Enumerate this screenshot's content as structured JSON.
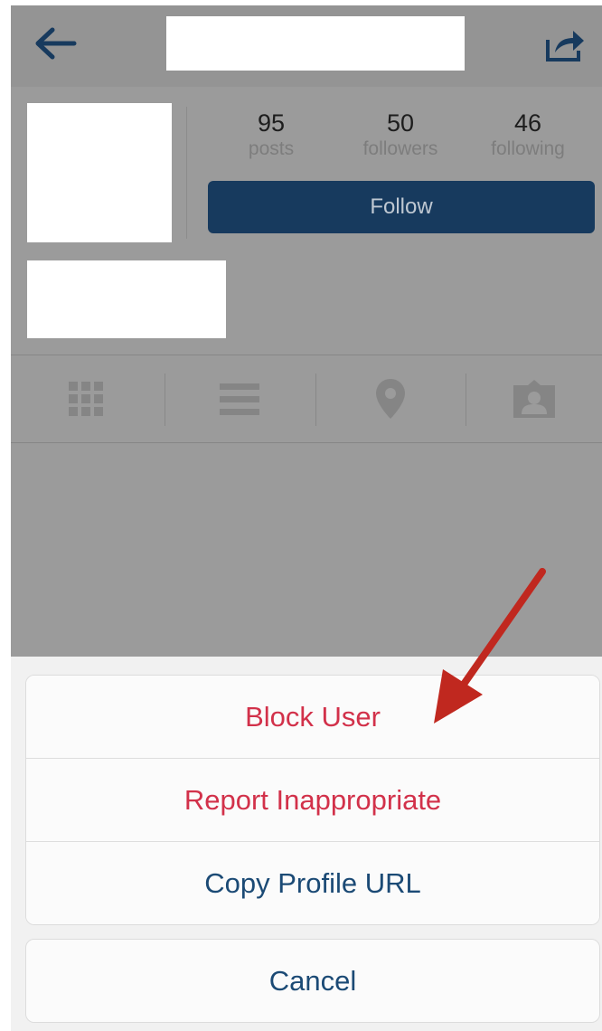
{
  "header": {
    "back_icon": "arrow-left-icon",
    "share_icon": "share-icon"
  },
  "profile": {
    "stats": [
      {
        "count": "95",
        "label": "posts"
      },
      {
        "count": "50",
        "label": "followers"
      },
      {
        "count": "46",
        "label": "following"
      }
    ],
    "follow_label": "Follow"
  },
  "tabs": [
    {
      "icon": "grid-icon"
    },
    {
      "icon": "list-icon"
    },
    {
      "icon": "location-pin-icon"
    },
    {
      "icon": "tagged-person-icon"
    }
  ],
  "action_sheet": {
    "items": [
      {
        "label": "Block User",
        "style": "destructive"
      },
      {
        "label": "Report Inappropriate",
        "style": "destructive"
      },
      {
        "label": "Copy Profile URL",
        "style": "normal"
      }
    ],
    "cancel_label": "Cancel"
  },
  "colors": {
    "overlay": "#9b9b9b",
    "follow_button": "#173a5e",
    "destructive_text": "#d2314a",
    "normal_text": "#1b4a75",
    "annotation_arrow": "#c0281f"
  }
}
